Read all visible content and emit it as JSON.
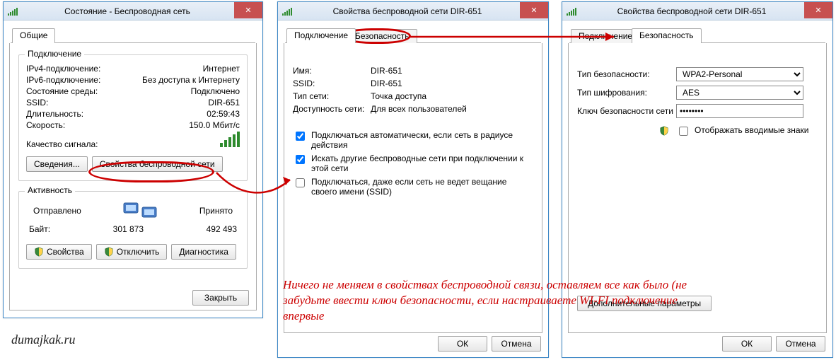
{
  "watermark": "dumajkak.ru",
  "annotation_text": "Ничего не меняем в свойствах беспроводной связи, оставляем все как было (не забудьте ввести ключ безопасности, если настраиваете WI-FI подключение впервые",
  "win1": {
    "title": "Состояние - Беспроводная сеть",
    "tab_general": "Общие",
    "grp_connection": "Подключение",
    "rows": {
      "ipv4_l": "IPv4-подключение:",
      "ipv4_v": "Интернет",
      "ipv6_l": "IPv6-подключение:",
      "ipv6_v": "Без доступа к Интернету",
      "media_l": "Состояние среды:",
      "media_v": "Подключено",
      "ssid_l": "SSID:",
      "ssid_v": "DIR-651",
      "dur_l": "Длительность:",
      "dur_v": "02:59:43",
      "speed_l": "Скорость:",
      "speed_v": "150.0 Мбит/c",
      "sigq_l": "Качество сигнала:"
    },
    "details_btn": "Сведения...",
    "props_btn": "Свойства беспроводной сети",
    "grp_activity": "Активность",
    "sent_l": "Отправлено",
    "recv_l": "Принято",
    "bytes_l": "Байт:",
    "sent_v": "301 873",
    "recv_v": "492 493",
    "b_props": "Свойства",
    "b_disable": "Отключить",
    "b_diag": "Диагностика",
    "b_close": "Закрыть"
  },
  "win2": {
    "title": "Свойства беспроводной сети DIR-651",
    "tab_conn": "Подключение",
    "tab_sec": "Безопасность",
    "name_l": "Имя:",
    "name_v": "DIR-651",
    "ssid_l": "SSID:",
    "ssid_v": "DIR-651",
    "type_l": "Тип сети:",
    "type_v": "Точка доступа",
    "avail_l": "Доступность сети:",
    "avail_v": "Для всех пользователей",
    "chk1": "Подключаться автоматически, если сеть в радиусе действия",
    "chk2": "Искать другие беспроводные сети при подключении к этой сети",
    "chk3": "Подключаться, даже если сеть не ведет вещание своего имени (SSID)",
    "ok": "ОК",
    "cancel": "Отмена"
  },
  "win3": {
    "title": "Свойства беспроводной сети DIR-651",
    "tab_conn": "Подключение",
    "tab_sec": "Безопасность",
    "sectype_l": "Тип безопасности:",
    "sectype_v": "WPA2-Personal",
    "enc_l": "Тип шифрования:",
    "enc_v": "AES",
    "key_l": "Ключ безопасности сети",
    "key_v": "••••••••",
    "showchars": "Отображать вводимые знаки",
    "adv_btn": "Дополнительные параметры",
    "ok": "ОК",
    "cancel": "Отмена"
  }
}
